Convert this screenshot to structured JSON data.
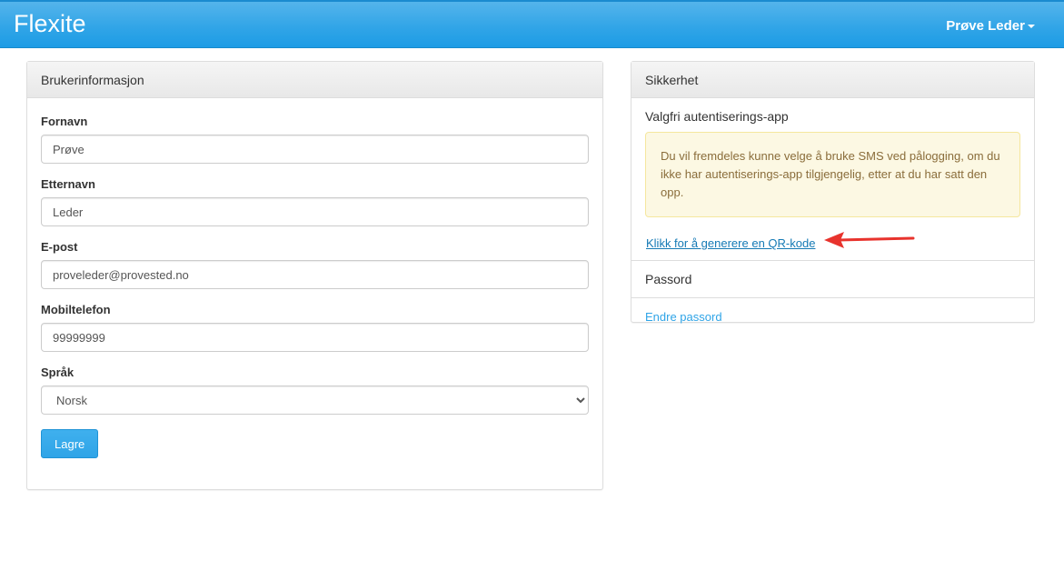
{
  "navbar": {
    "brand": "Flexite",
    "user_name": "Prøve Leder"
  },
  "user_panel": {
    "title": "Brukerinformasjon",
    "fields": {
      "first_name": {
        "label": "Fornavn",
        "value": "Prøve"
      },
      "last_name": {
        "label": "Etternavn",
        "value": "Leder"
      },
      "email": {
        "label": "E-post",
        "value": "proveleder@provested.no"
      },
      "mobile": {
        "label": "Mobiltelefon",
        "value": "99999999"
      },
      "language": {
        "label": "Språk",
        "selected": "Norsk"
      }
    },
    "save_label": "Lagre"
  },
  "security_panel": {
    "title": "Sikkerhet",
    "auth_app_heading": "Valgfri autentiserings-app",
    "alert_text": "Du vil fremdeles kunne velge å bruke SMS ved pålogging, om du ikke har autentiserings-app tilgjengelig, etter at du har satt den opp.",
    "qr_link": "Klikk for å generere en QR-kode",
    "password_heading": "Passord",
    "change_password_link": "Endre passord"
  },
  "colors": {
    "navbar": "#2fa4e7",
    "link": "#2fa4e7",
    "alert_bg": "#fcf8e3",
    "arrow": "#e8332d"
  },
  "icons": {
    "user_caret": "caret-down-icon",
    "select_chevron": "chevron-down-icon",
    "annotation": "red-arrow-left-icon"
  }
}
